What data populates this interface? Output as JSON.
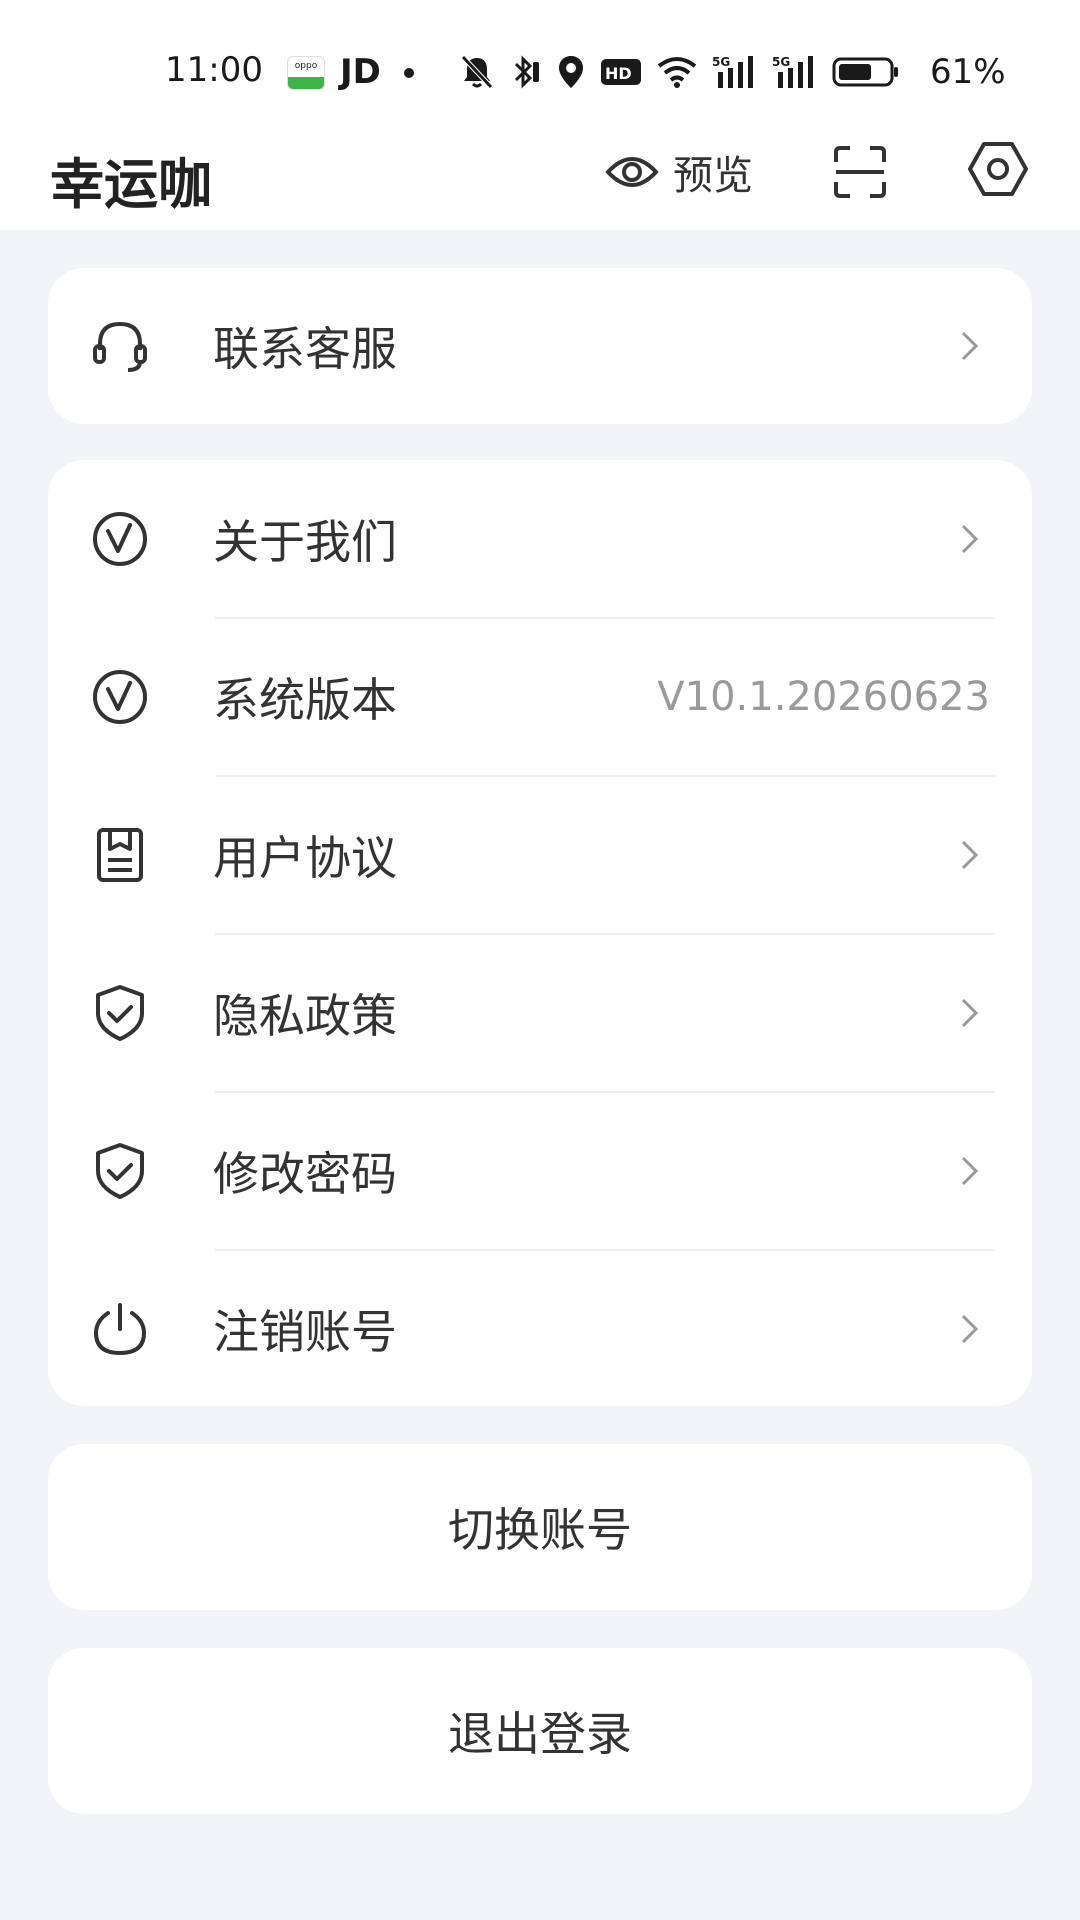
{
  "status_bar": {
    "time": "11:00",
    "app_label": "JD",
    "battery_percent": "61%",
    "icons": [
      "oppo-app-icon",
      "mute-icon",
      "bluetooth-icon",
      "location-icon",
      "hd-icon",
      "wifi-icon",
      "signal-5g-icon",
      "signal-5g-icon",
      "battery-icon"
    ]
  },
  "header": {
    "title": "幸运咖",
    "preview_label": "预览"
  },
  "service": {
    "label": "联系客服"
  },
  "menu": {
    "items": [
      {
        "label": "关于我们",
        "icon": "v-circle-icon"
      },
      {
        "label": "系统版本",
        "icon": "v-circle-icon",
        "value": "V10.1.20260623"
      },
      {
        "label": "用户协议",
        "icon": "document-icon"
      },
      {
        "label": "隐私政策",
        "icon": "shield-check-icon"
      },
      {
        "label": "修改密码",
        "icon": "shield-check-icon"
      },
      {
        "label": "注销账号",
        "icon": "power-icon"
      }
    ]
  },
  "actions": {
    "switch_account": "切换账号",
    "logout": "退出登录"
  },
  "colors": {
    "background": "#F3F4F8",
    "card": "#FFFFFF",
    "text": "#333333",
    "secondary_text": "#9A9A9A"
  }
}
